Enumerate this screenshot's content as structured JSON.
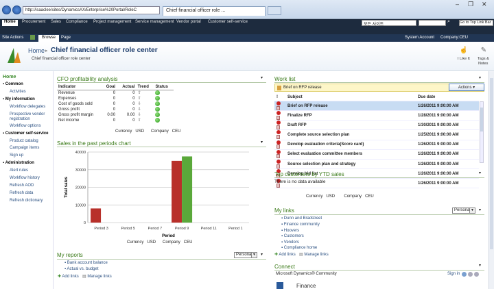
{
  "browser": {
    "url": "http://isaaclee/sites/DynamicsAX/Enterprise%20Portal/RoleC",
    "tab_title": "Chief financial officer role ...",
    "controls": [
      "–",
      "❐",
      "✕"
    ]
  },
  "topnav": {
    "items": [
      "Home",
      "Procurement",
      "Sales",
      "Compliance",
      "Project management",
      "Service management",
      "Vendor portal",
      "Customer self-service"
    ],
    "search_scope": "모든 사이트",
    "goto": "Go to Top Link Bar"
  },
  "ribbon": {
    "site_actions": "Site Actions",
    "browse": "Browse",
    "page": "Page",
    "account": "System Account",
    "company": "Company:CEU"
  },
  "title": {
    "home": "Home",
    "separator": "▸",
    "page_title": "Chief financial officer role center",
    "subtitle": "Chief financial officer role center",
    "ilike": "I Like It",
    "tags": "Tags &",
    "notes": "Notes"
  },
  "leftnav": [
    {
      "t": "Home",
      "h": true
    },
    {
      "t": "Common",
      "h": true
    },
    {
      "t": "Activities"
    },
    {
      "t": "My information",
      "h": true
    },
    {
      "t": "Workflow delegates"
    },
    {
      "t": "Prospective vendor"
    },
    {
      "t": "registration"
    },
    {
      "t": "Workflow options"
    },
    {
      "t": "Customer self-service",
      "h": true
    },
    {
      "t": "Product catalog"
    },
    {
      "t": "Campaign items"
    },
    {
      "t": "Sign up"
    },
    {
      "t": "Administration",
      "h": true
    },
    {
      "t": "Alert rules"
    },
    {
      "t": "Workflow history"
    },
    {
      "t": "Refresh AOD"
    },
    {
      "t": "Refresh data"
    },
    {
      "t": "Refresh dictionary"
    }
  ],
  "cfo": {
    "title": "CFO profitability analysis",
    "headers": [
      "Indicator",
      "Goal",
      "Actual",
      "Trend",
      "Status"
    ],
    "rows": [
      [
        "Revenue",
        "0",
        "0"
      ],
      [
        "Expenses",
        "0",
        "0"
      ],
      [
        "Cost of goods sold",
        "0",
        "0"
      ],
      [
        "Gross profit",
        "0",
        "0"
      ],
      [
        "Gross profit margin",
        "0.00",
        "0.00"
      ],
      [
        "Net income",
        "0",
        "0"
      ]
    ],
    "footer": [
      "Currency",
      "USD",
      "Company",
      "CEU"
    ]
  },
  "sales": {
    "title": "Sales in the past periods chart",
    "footer": [
      "Currency",
      "USD",
      "Company",
      "CEU"
    ]
  },
  "chart_data": {
    "type": "bar",
    "categories": [
      "Period 3",
      "Period 5",
      "Period 7",
      "Period 9",
      "Period 11",
      "Period 1"
    ],
    "series": [
      {
        "values": [
          8000,
          0,
          0,
          35000,
          0,
          0
        ],
        "color": "#b8302a"
      },
      {
        "values": [
          0,
          0,
          0,
          37500,
          0,
          0
        ],
        "color": "#5aa83a"
      }
    ],
    "title": "",
    "xlabel": "Period",
    "ylabel": "Total sales",
    "ylim": [
      0,
      40000
    ],
    "yticks": [
      "40000",
      "30000",
      "20000",
      "10000",
      "0"
    ]
  },
  "reports": {
    "title": "My reports",
    "select": "Personal",
    "items": [
      "Bank account balance",
      "Actual vs. budget"
    ],
    "add": "Add links",
    "manage": "Manage links"
  },
  "worklist": {
    "title": "Work list",
    "selected": "Brief on RFP release",
    "actions": "Actions",
    "headers": [
      "!",
      "Subject",
      "Due date"
    ],
    "rows": [
      [
        "Brief on RFP release",
        "1/26/2011 9:00:00 AM"
      ],
      [
        "Finalize RFP",
        "1/28/2011 9:00:00 AM"
      ],
      [
        "Draft RFP",
        "1/30/2011 9:00:00 AM"
      ],
      [
        "Complete source selection plan",
        "1/25/2011 9:00:00 AM"
      ],
      [
        "Develop evaluation criteria(Score card)",
        "1/26/2011 9:00:00 AM"
      ],
      [
        "Select evaluation committee members",
        "1/26/2011 9:00:00 AM"
      ],
      [
        "Source selection plan and strategy",
        "1/26/2011 9:00:00 AM"
      ],
      [
        "Develop bid list",
        "1/26/2011 9:00:00 AM"
      ],
      [
        "",
        "1/26/2011 9:00:00 AM"
      ]
    ]
  },
  "topcust": {
    "title": "Top customers by YTD sales",
    "empty": "There is no data available",
    "footer": [
      "Currency",
      "USD",
      "Company",
      "CEU"
    ]
  },
  "mylinks": {
    "title": "My links",
    "select": "Personal",
    "items": [
      "Dunn and Bradstreet",
      "Finance community",
      "Hoovers",
      "Customers",
      "Vendors",
      "Compliance home"
    ],
    "add": "Add links",
    "manage": "Manage links"
  },
  "connect": {
    "title": "Connect",
    "community": "Microsoft Dynamics® Community",
    "signin": "Sign in",
    "finance": "Finance"
  }
}
